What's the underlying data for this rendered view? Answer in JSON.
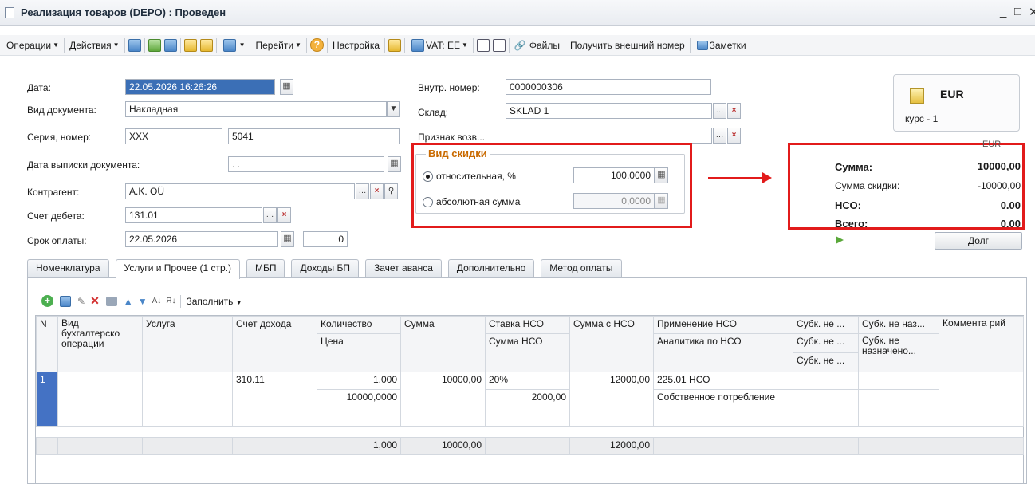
{
  "window": {
    "title": "Реализация товаров (DEPO) : Проведен",
    "min_glyph": "_",
    "max_glyph": "□",
    "close_glyph": "✕"
  },
  "toolbar": {
    "operations": "Операции",
    "actions": "Действия",
    "goto": "Перейти",
    "settings": "Настройка",
    "vat": "VAT: EE",
    "files": "Файлы",
    "external_number": "Получить внешний номер",
    "notes": "Заметки"
  },
  "form": {
    "date_label": "Дата:",
    "date_value": "22.05.2026 16:26:26",
    "doc_type_label": "Вид документа:",
    "doc_type_value": "Накладная",
    "series_label": "Серия, номер:",
    "series_value": "XXX",
    "number_value": "5041",
    "issue_date_label": "Дата выписки документа:",
    "issue_date_value": ". .",
    "counterparty_label": "Контрагент:",
    "counterparty_value": "A.K. OÜ",
    "debit_label": "Счет дебета:",
    "debit_value": "131.01",
    "due_label": "Срок оплаты:",
    "due_value": "22.05.2026",
    "due_days": "0",
    "inner_number_label": "Внутр. номер:",
    "inner_number_value": "0000000306",
    "warehouse_label": "Склад:",
    "warehouse_value": "SKLAD 1",
    "return_label": "Признак возв...",
    "return_value": ""
  },
  "discount": {
    "legend": "Вид скидки",
    "relative_label": "относительная, %",
    "relative_value": "100,0000",
    "absolute_label": "абсолютная сумма",
    "absolute_value": "0,0000"
  },
  "currency": {
    "code": "EUR",
    "rate": "курс - 1"
  },
  "totals": {
    "currency": "EUR",
    "sum_label": "Сумма:",
    "sum_value": "10000,00",
    "discount_label": "Сумма скидки:",
    "discount_value": "-10000,00",
    "vat_label": "НСО:",
    "vat_value": "0.00",
    "total_label": "Всего:",
    "total_value": "0.00",
    "debt_button": "Долг"
  },
  "tabs": [
    {
      "label": "Номенклатура"
    },
    {
      "label": "Услуги и Прочее (1 стр.)"
    },
    {
      "label": "МБП"
    },
    {
      "label": "Доходы БП"
    },
    {
      "label": "Зачет аванса"
    },
    {
      "label": "Дополнительно"
    },
    {
      "label": "Метод оплаты"
    }
  ],
  "table_toolbar": {
    "fill": "Заполнить"
  },
  "table": {
    "headers": {
      "n": "N",
      "op_type": "Вид бухгалтерско операции",
      "service": "Услуга",
      "income_account": "Счет дохода",
      "quantity": "Количество",
      "price": "Цена",
      "sum": "Сумма",
      "vat_rate": "Ставка НСО",
      "vat_sum": "Сумма НСО",
      "sum_with_vat": "Сумма с НСО",
      "vat_application": "Применение НСО",
      "vat_analytics": "Аналитика по НСО",
      "sub1": "Субк. не ...",
      "sub2": "Субк. не ...",
      "sub3": "Субк. не ...",
      "sub_not_assigned": "Субк. не наз...",
      "sub_not_assigned2": "Субк. не назначено...",
      "comment": "Коммента рий"
    },
    "row": {
      "n": "1",
      "income_account": "310.11",
      "quantity": "1,000",
      "price": "10000,0000",
      "sum": "10000,00",
      "vat_rate": "20%",
      "vat_sum": "2000,00",
      "sum_with_vat": "12000,00",
      "vat_application": "225.01 НСО",
      "vat_analytics": "Собственное потребление"
    },
    "footer": {
      "quantity": "1,000",
      "sum": "10000,00",
      "sum_with_vat": "12000,00"
    }
  }
}
